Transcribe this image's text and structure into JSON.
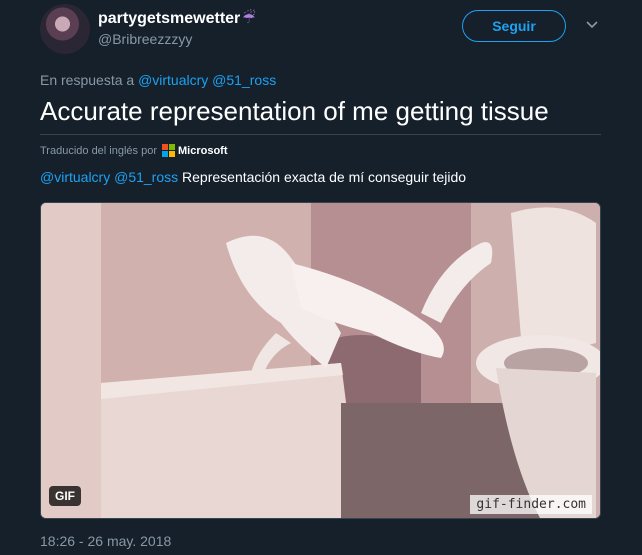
{
  "user": {
    "display_name": "partygetsmewetter",
    "name_emoji": "☔",
    "handle": "@Bribreezzzyy"
  },
  "follow_button": {
    "label": "Seguir"
  },
  "reply_context": {
    "prefix": "En respuesta a",
    "mentions": [
      "@virtualcry",
      "@51_ross"
    ]
  },
  "tweet": {
    "text": "Accurate representation of me getting tissue",
    "translation_label": "Traducido del inglés por",
    "translator": "Microsoft",
    "translation_mentions": [
      "@virtualcry",
      "@51_ross"
    ],
    "translation_text": "Representación exacta de mí conseguir tejido"
  },
  "media": {
    "badge": "GIF",
    "watermark": "gif-finder.com"
  },
  "timestamp": "18:26 - 26 may. 2018",
  "colors": {
    "background": "#15202b",
    "accent": "#1da1f2",
    "muted": "#8899a6",
    "ms_red": "#f25022",
    "ms_green": "#7fba00",
    "ms_blue": "#00a4ef",
    "ms_yellow": "#ffb900"
  }
}
